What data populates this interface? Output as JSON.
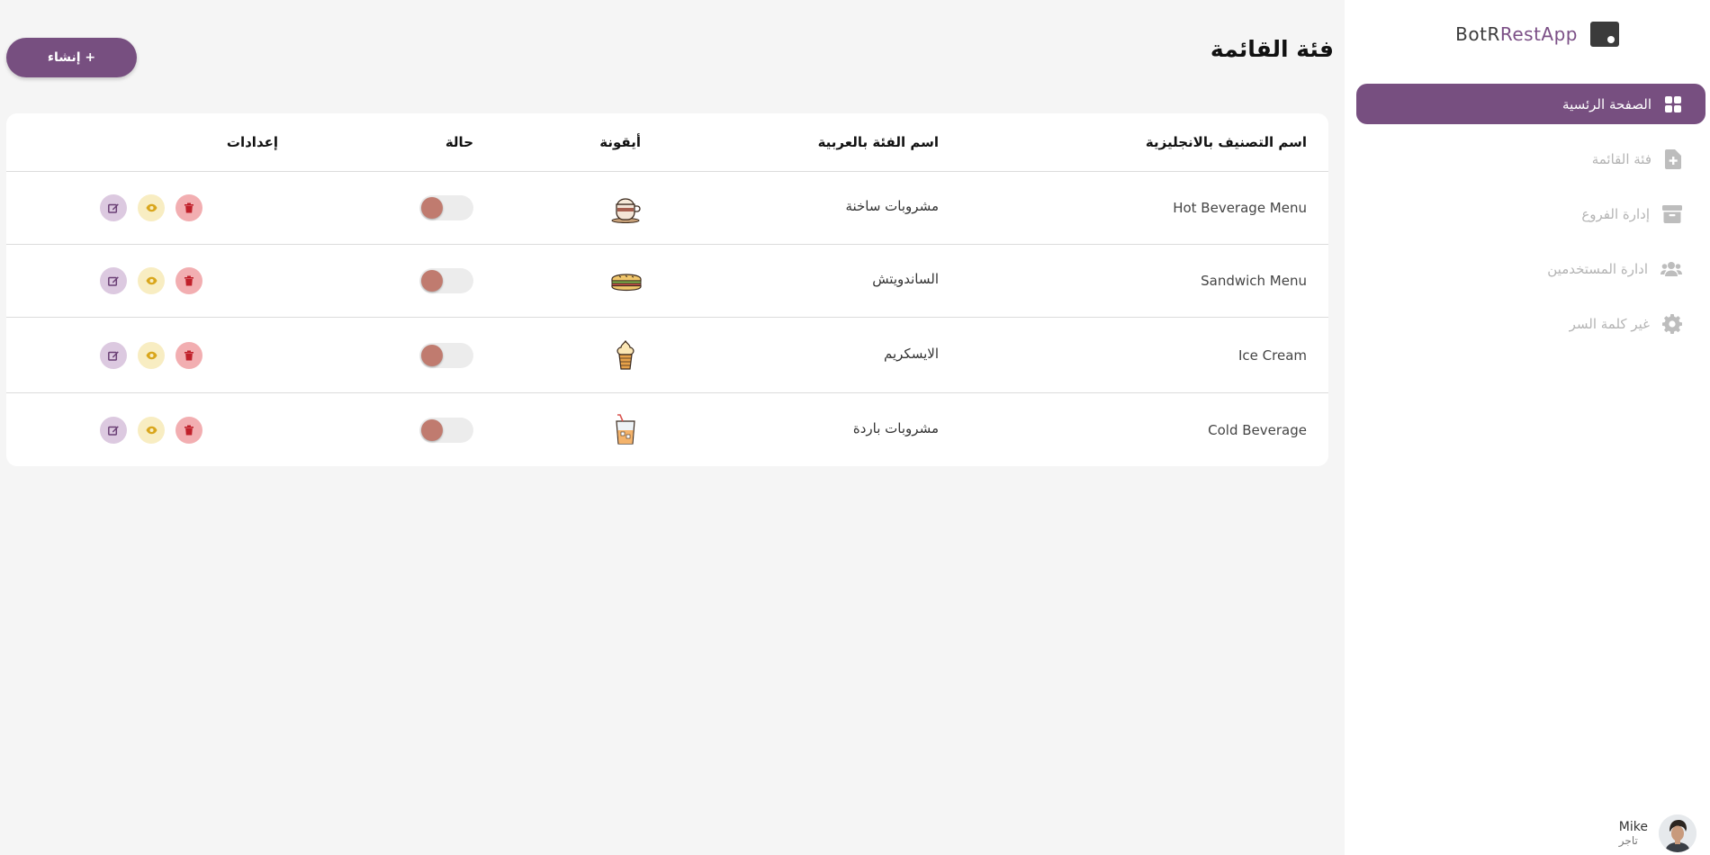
{
  "app": {
    "brand_prefix": "BotR",
    "brand_suffix": "RestApp"
  },
  "sidebar": {
    "items": [
      {
        "label": "الصفحة الرئسية",
        "icon": "dashboard-grid-icon",
        "active": true
      },
      {
        "label": "فئة القائمة",
        "icon": "file-plus-icon",
        "active": false
      },
      {
        "label": "إدارة الفروع",
        "icon": "archive-box-icon",
        "active": false
      },
      {
        "label": "ادارة المستخدمين",
        "icon": "users-icon",
        "active": false
      },
      {
        "label": "غير كلمة السر",
        "icon": "gear-icon",
        "active": false
      }
    ]
  },
  "user": {
    "name": "Mike",
    "role": "تاجر"
  },
  "page": {
    "title": "فئة القائمة",
    "create_label": "إنشاء +"
  },
  "table": {
    "headers": {
      "name_en": "اسم التصنيف بالانجليزية",
      "name_ar": "اسم الفئة بالعربية",
      "icon": "أيقونة",
      "status": "حالة",
      "settings": "إعدادات"
    },
    "rows": [
      {
        "name_en": "Hot Beverage Menu",
        "name_ar": "مشروبات ساخنة",
        "icon": "hot-coffee-cup-icon",
        "status": false
      },
      {
        "name_en": "Sandwich Menu",
        "name_ar": "الساندويتش",
        "icon": "sandwich-icon",
        "status": false
      },
      {
        "name_en": "Ice Cream",
        "name_ar": "الايسكريم",
        "icon": "ice-cream-icon",
        "status": false
      },
      {
        "name_en": "Cold Beverage",
        "name_ar": "مشروبات باردة",
        "icon": "cold-drink-icon",
        "status": false
      }
    ]
  },
  "colors": {
    "accent": "#774f80",
    "toggle_knob": "#c07b6f",
    "delete_bg": "#f2aeb1",
    "view_bg": "#f8edc2",
    "edit_bg": "#dcc9e0"
  }
}
